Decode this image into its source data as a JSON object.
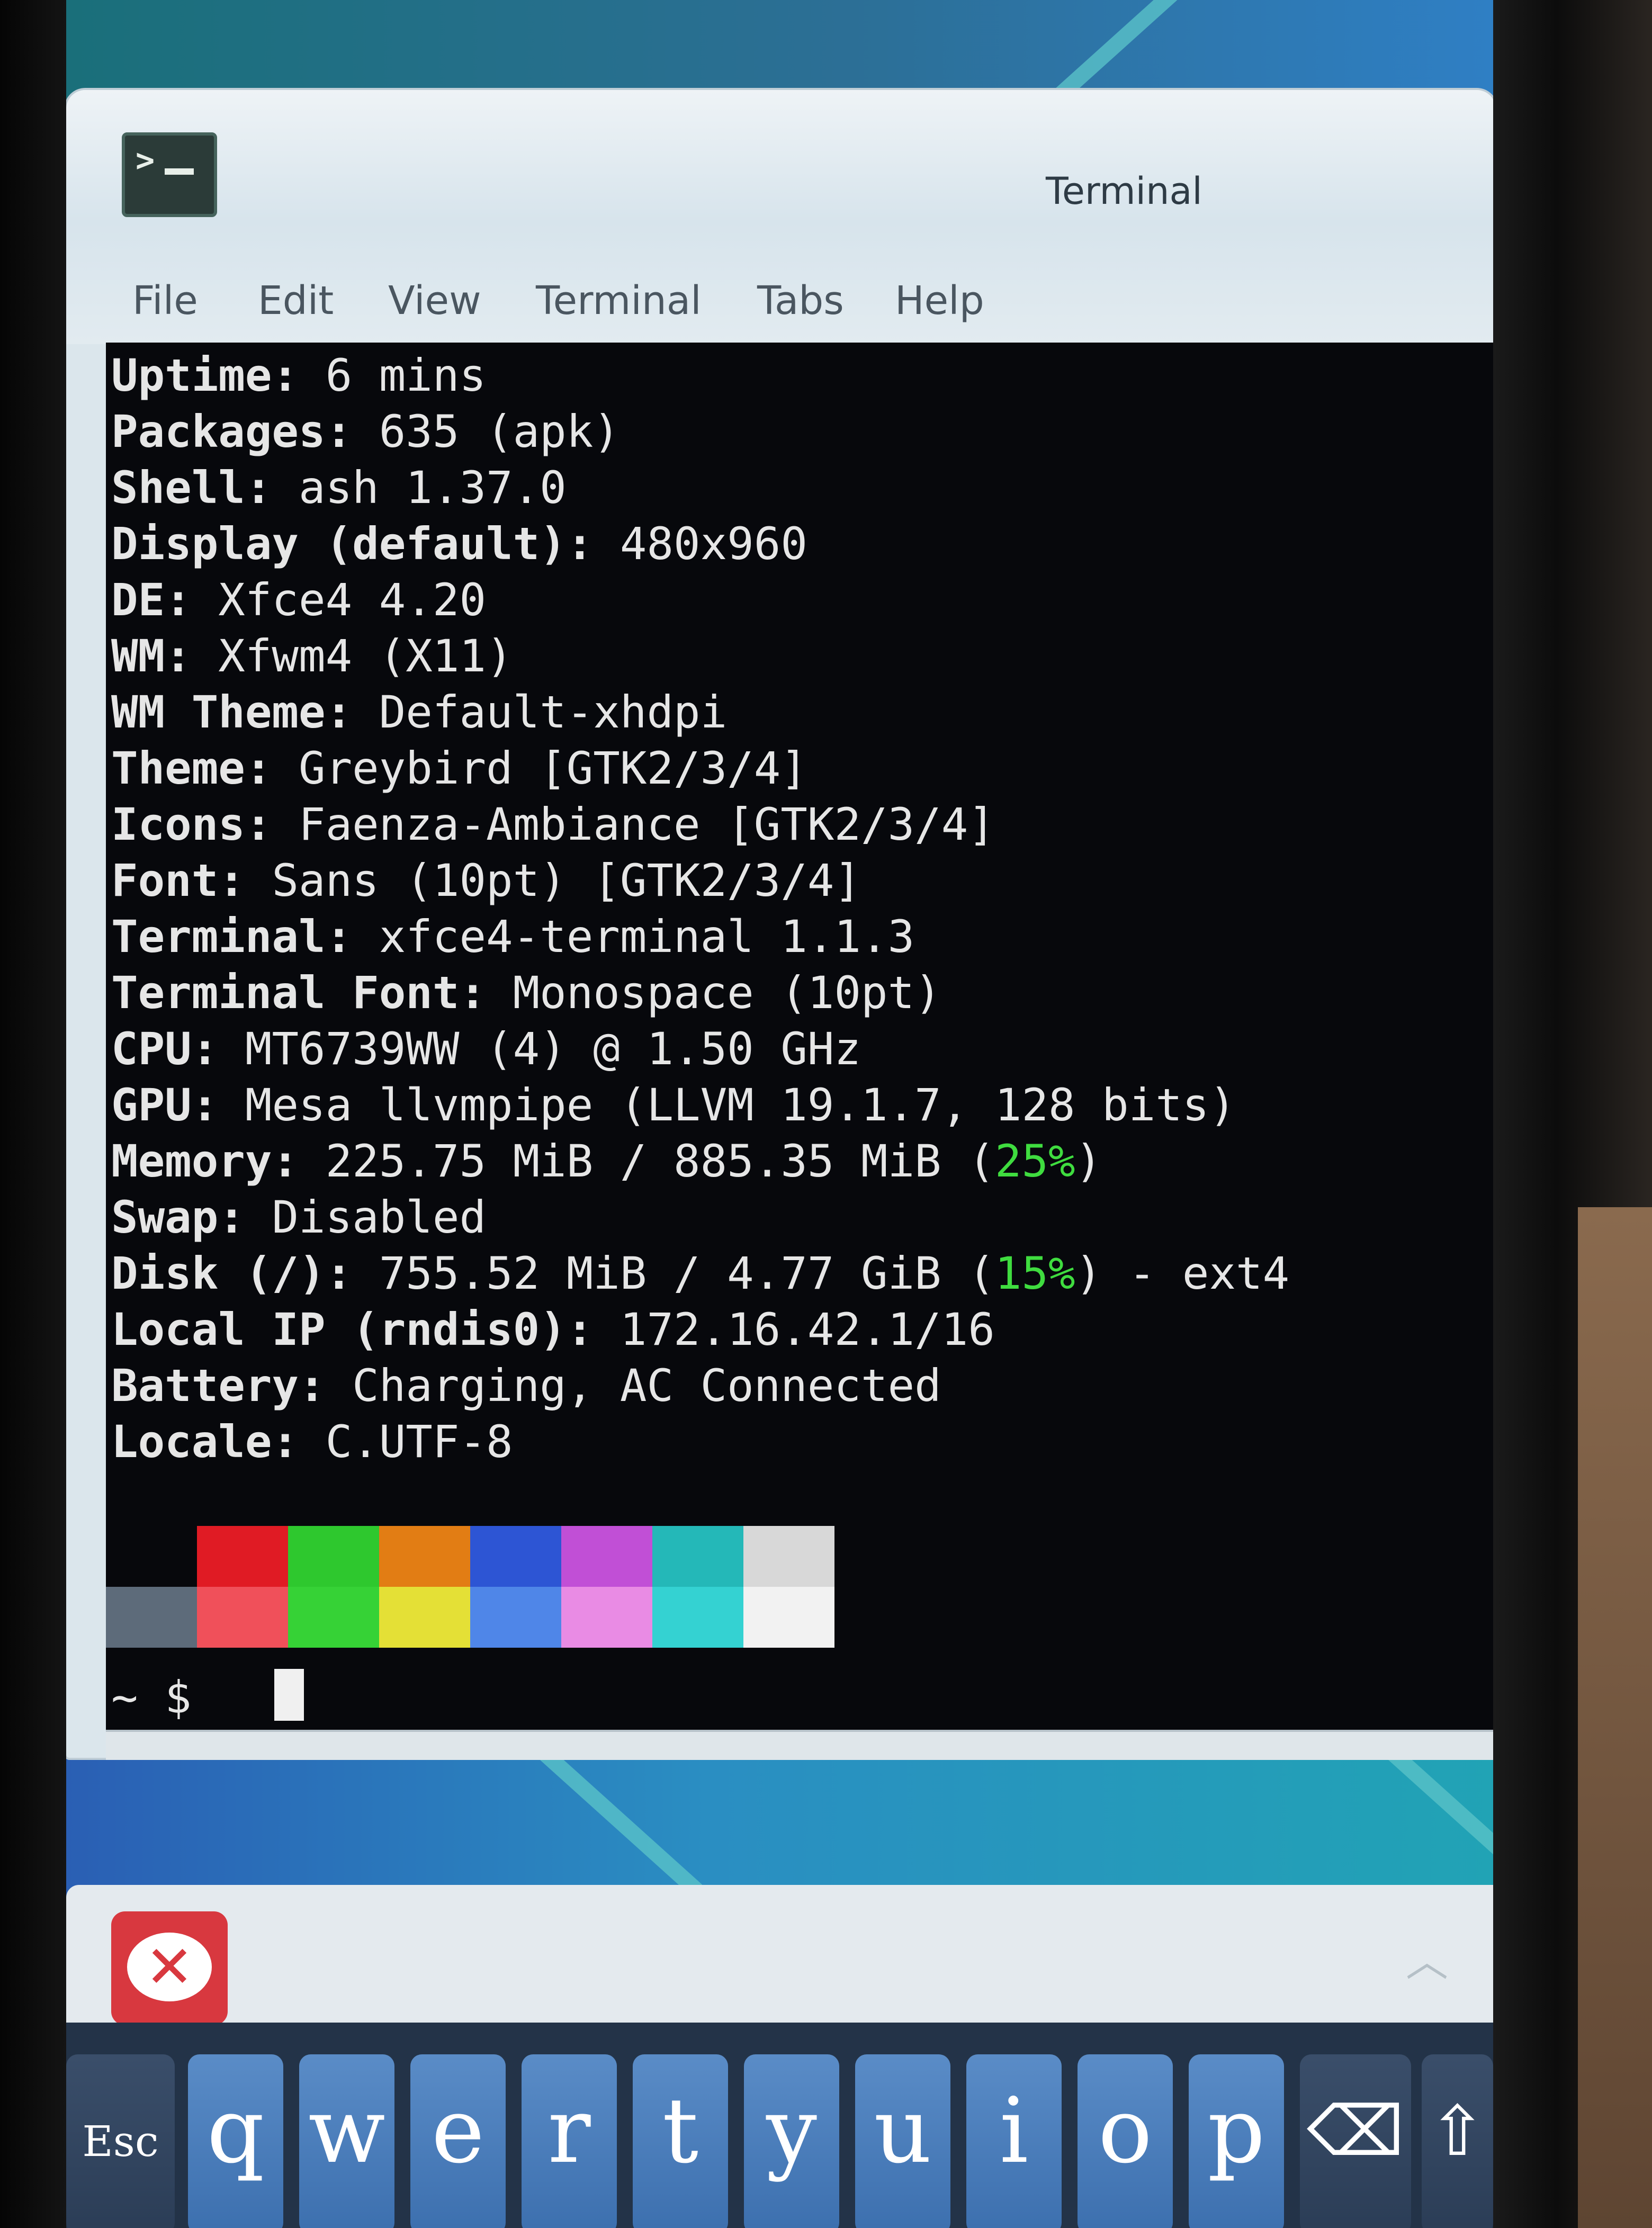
{
  "window": {
    "title": "Terminal",
    "menu": [
      "File",
      "Edit",
      "View",
      "Terminal",
      "Tabs",
      "Help"
    ]
  },
  "terminal": {
    "lines": [
      {
        "label": "Uptime:",
        "value": " 6 mins"
      },
      {
        "label": "Packages:",
        "value": " 635 (apk)"
      },
      {
        "label": "Shell:",
        "value": " ash 1.37.0"
      },
      {
        "label": "Display (default):",
        "value": " 480x960"
      },
      {
        "label": "DE:",
        "value": " Xfce4 4.20"
      },
      {
        "label": "WM:",
        "value": " Xfwm4 (X11)"
      },
      {
        "label": "WM Theme:",
        "value": " Default-xhdpi"
      },
      {
        "label": "Theme:",
        "value": " Greybird [GTK2/3/4]"
      },
      {
        "label": "Icons:",
        "value": " Faenza-Ambiance [GTK2/3/4]"
      },
      {
        "label": "Font:",
        "value": " Sans (10pt) [GTK2/3/4]"
      },
      {
        "label": "Terminal:",
        "value": " xfce4-terminal 1.1.3"
      },
      {
        "label": "Terminal Font:",
        "value": " Monospace (10pt)"
      },
      {
        "label": "CPU:",
        "value": " MT6739WW (4) @ 1.50 GHz"
      },
      {
        "label": "GPU:",
        "value": " Mesa llvmpipe (LLVM 19.1.7, 128 bits)"
      },
      {
        "label": "Memory:",
        "value": " 225.75 MiB / 885.35 MiB (",
        "pct": "25%",
        "tail": ")"
      },
      {
        "label": "Swap:",
        "value": " Disabled"
      },
      {
        "label": "Disk (/):",
        "value": " 755.52 MiB / 4.77 GiB (",
        "pct": "15%",
        "tail": ") - ext4"
      },
      {
        "label": "Local IP (rndis0):",
        "value": " 172.16.42.1/16"
      },
      {
        "label": "Battery:",
        "value": " Charging, AC Connected"
      },
      {
        "label": "Locale:",
        "value": " C.UTF-8"
      }
    ],
    "palette_top": [
      "#07080c",
      "#e01b24",
      "#2ec82e",
      "#e27d14",
      "#2d55d4",
      "#c14fd6",
      "#24b8b8",
      "#d8d8d8"
    ],
    "palette_bottom": [
      "#5d6b7a",
      "#f0505a",
      "#36d236",
      "#e4e036",
      "#4f86e8",
      "#e98be4",
      "#34d2d2",
      "#f2f2f2"
    ],
    "prompt": "~ $"
  },
  "keyboard": {
    "keys": [
      "Esc",
      "q",
      "w",
      "e",
      "r",
      "t",
      "y",
      "u",
      "i",
      "o",
      "p",
      "⌫",
      "⇧"
    ]
  },
  "panel": {
    "up_glyph": "︿"
  }
}
